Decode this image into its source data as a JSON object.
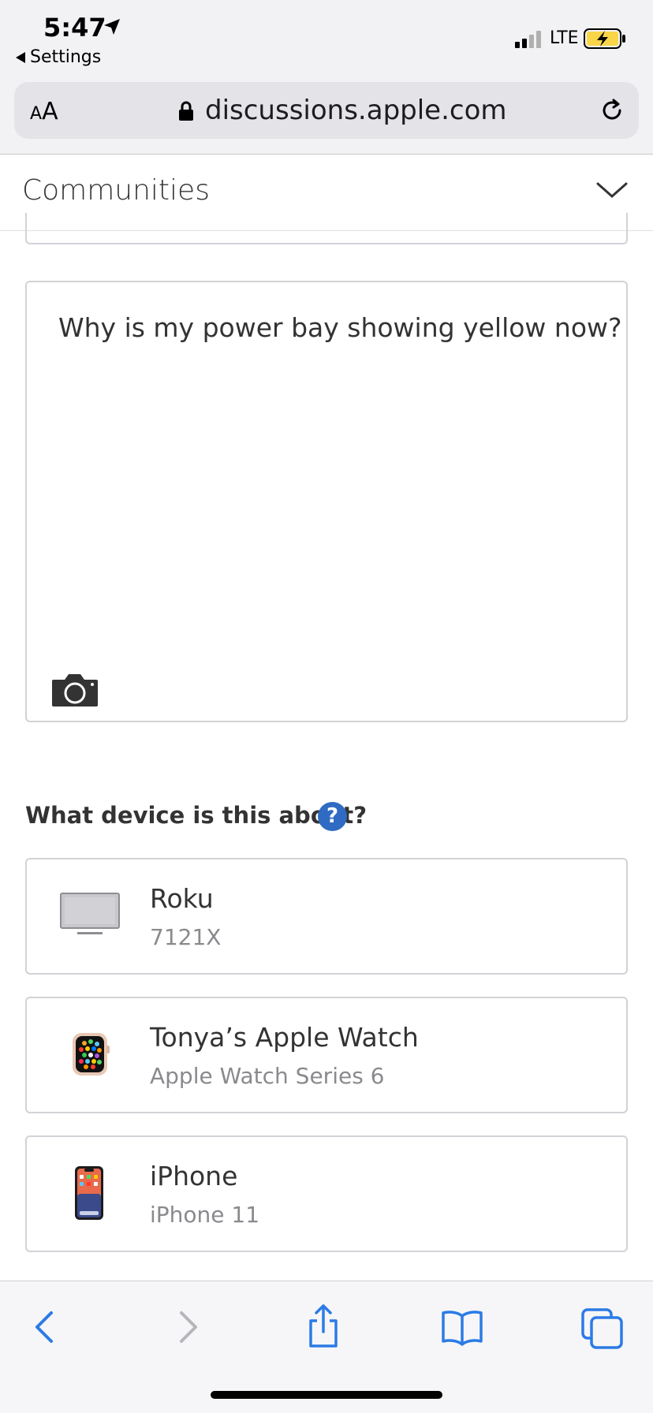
{
  "status_bar": {
    "time": "5:47",
    "back_app": "Settings",
    "network": "LTE"
  },
  "browser": {
    "text_size_small": "A",
    "text_size_big": "A",
    "url": "discussions.apple.com"
  },
  "header": {
    "title": "Communities"
  },
  "question": {
    "text": "Why is my power bay showing yellow now?"
  },
  "devices": {
    "prompt": "What device is this about?",
    "help_label": "?",
    "items": [
      {
        "name": "Roku",
        "model": "7121X",
        "icon": "monitor-icon"
      },
      {
        "name": "Tonya’s Apple Watch",
        "model": "Apple Watch Series 6",
        "icon": "apple-watch-icon"
      },
      {
        "name": "iPhone",
        "model": "iPhone 11",
        "icon": "iphone-icon"
      }
    ]
  },
  "colors": {
    "accent_blue": "#2f6bc3",
    "toolbar_blue": "#2c7be5",
    "toolbar_disabled": "#b5b5bb",
    "battery_yellow": "#f9d548"
  }
}
